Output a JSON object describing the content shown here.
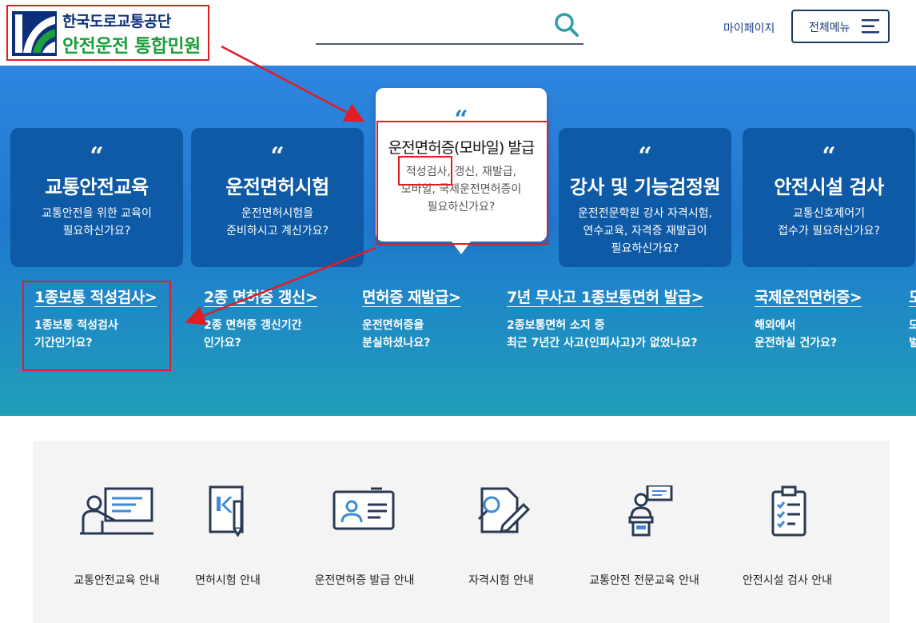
{
  "header": {
    "org_name": "한국도로교통공단",
    "service_name": "안전운전 통합민원",
    "search_placeholder": "",
    "mypage_label": "마이페이지",
    "allmenu_label": "전체메뉴"
  },
  "hero": {
    "cards": [
      {
        "title": "교통안전교육",
        "desc_1": "교통안전을 위한 교육이",
        "desc_2": "필요하신가요?",
        "desc_3": ""
      },
      {
        "title": "운전면허시험",
        "desc_1": "운전면허시험을",
        "desc_2": "준비하시고 계신가요?",
        "desc_3": ""
      },
      {
        "title": "운전면허증(모바일) 발급",
        "desc_1": "적성검사, 갱신, 재발급,",
        "desc_2": "모바일, 국제운전면허증이",
        "desc_3": "필요하신가요?"
      },
      {
        "title": "강사 및 기능검정원",
        "desc_1": "운전전문학원 강사 자격시험,",
        "desc_2": "연수교육, 자격증 재발급이",
        "desc_3": "필요하신가요?"
      },
      {
        "title": "안전시설 검사",
        "desc_1": "교통신호제어기",
        "desc_2": "접수가 필요하신가요?",
        "desc_3": ""
      }
    ],
    "quick_links": [
      {
        "title": "1종보통 적성검사",
        "desc_1": "1종보통 적성검사",
        "desc_2": "기간인가요?"
      },
      {
        "title": "2종 면허증 갱신",
        "desc_1": "2종 면허증 갱신기간",
        "desc_2": "인가요?"
      },
      {
        "title": "면허증 재발급",
        "desc_1": "운전면허증을",
        "desc_2": "분실하셨나요?"
      },
      {
        "title": "7년 무사고 1종보통면허 발급",
        "desc_1": "2종보통면허 소지 중",
        "desc_2": "최근 7년간 사고(인피사고)가 없었나요?"
      },
      {
        "title": "국제운전면허증",
        "desc_1": "해외에서",
        "desc_2": "운전하실 건가요?"
      },
      {
        "title": "모",
        "desc_1": "모",
        "desc_2": "벌"
      }
    ],
    "chevron": ">",
    "quote_mark": "“"
  },
  "services": [
    {
      "label": "교통안전교육 안내",
      "icon": "presentation-icon"
    },
    {
      "label": "면허시험 안내",
      "icon": "license-document-icon"
    },
    {
      "label": "운전면허증 발급 안내",
      "icon": "id-card-icon"
    },
    {
      "label": "자격시험 안내",
      "icon": "exam-paper-icon"
    },
    {
      "label": "교통안전 전문교육 안내",
      "icon": "lecturer-podium-icon"
    },
    {
      "label": "안전시설 검사 안내",
      "icon": "checklist-clipboard-icon"
    }
  ],
  "colors": {
    "brand_navy": "#0b2f7a",
    "brand_green": "#1c9e3b",
    "hero_blue": "#2f86e0",
    "card_blue": "#0e5aa7",
    "annotation_red": "#e21c23"
  }
}
